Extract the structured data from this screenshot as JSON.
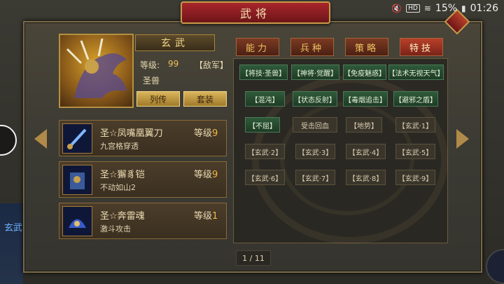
{
  "status_bar": {
    "battery": "15%",
    "time": "01:26",
    "network": "HD"
  },
  "window": {
    "title": "武将"
  },
  "general": {
    "name": "玄武",
    "level_label": "等级:",
    "level_value": "99",
    "faction": "【敌军】",
    "type": "圣兽",
    "bio_button": "列传",
    "set_button": "套装"
  },
  "equipment": [
    {
      "name": "圣☆凤嘴凰翼刀",
      "level_label": "等级",
      "level": "9",
      "desc": "九宫格穿透"
    },
    {
      "name": "圣☆獬豸铠",
      "level_label": "等级",
      "level": "9",
      "desc": "不动如山2"
    },
    {
      "name": "圣☆奔雷魂",
      "level_label": "等级",
      "level": "1",
      "desc": "激斗攻击"
    }
  ],
  "tabs": [
    "能力",
    "兵种",
    "策略",
    "特技"
  ],
  "active_tab": "特技",
  "skills": [
    [
      "【将技·圣兽】",
      "【神将·觉醒】",
      "【免疫魅惑】",
      "【法术无视天气】"
    ],
    [
      "【混沌】",
      "【状态反射】",
      "【毒烟追击】",
      "【避邪之盾】"
    ],
    [
      "【不屈】",
      "受击回血",
      "【地势】",
      "【玄武·1】"
    ],
    [
      "【玄武·2】",
      "【玄武·3】",
      "【玄武·4】",
      "【玄武·5】"
    ],
    [
      "【玄武·6】",
      "【玄武·7】",
      "【玄武·8】",
      "【玄武·9】"
    ]
  ],
  "pager": "1 / 11",
  "side_text": "玄武",
  "colors": {
    "accent_gold": "#f0c15f",
    "tab_red": "#7a2318",
    "skill_green": "#2f5a3a"
  }
}
